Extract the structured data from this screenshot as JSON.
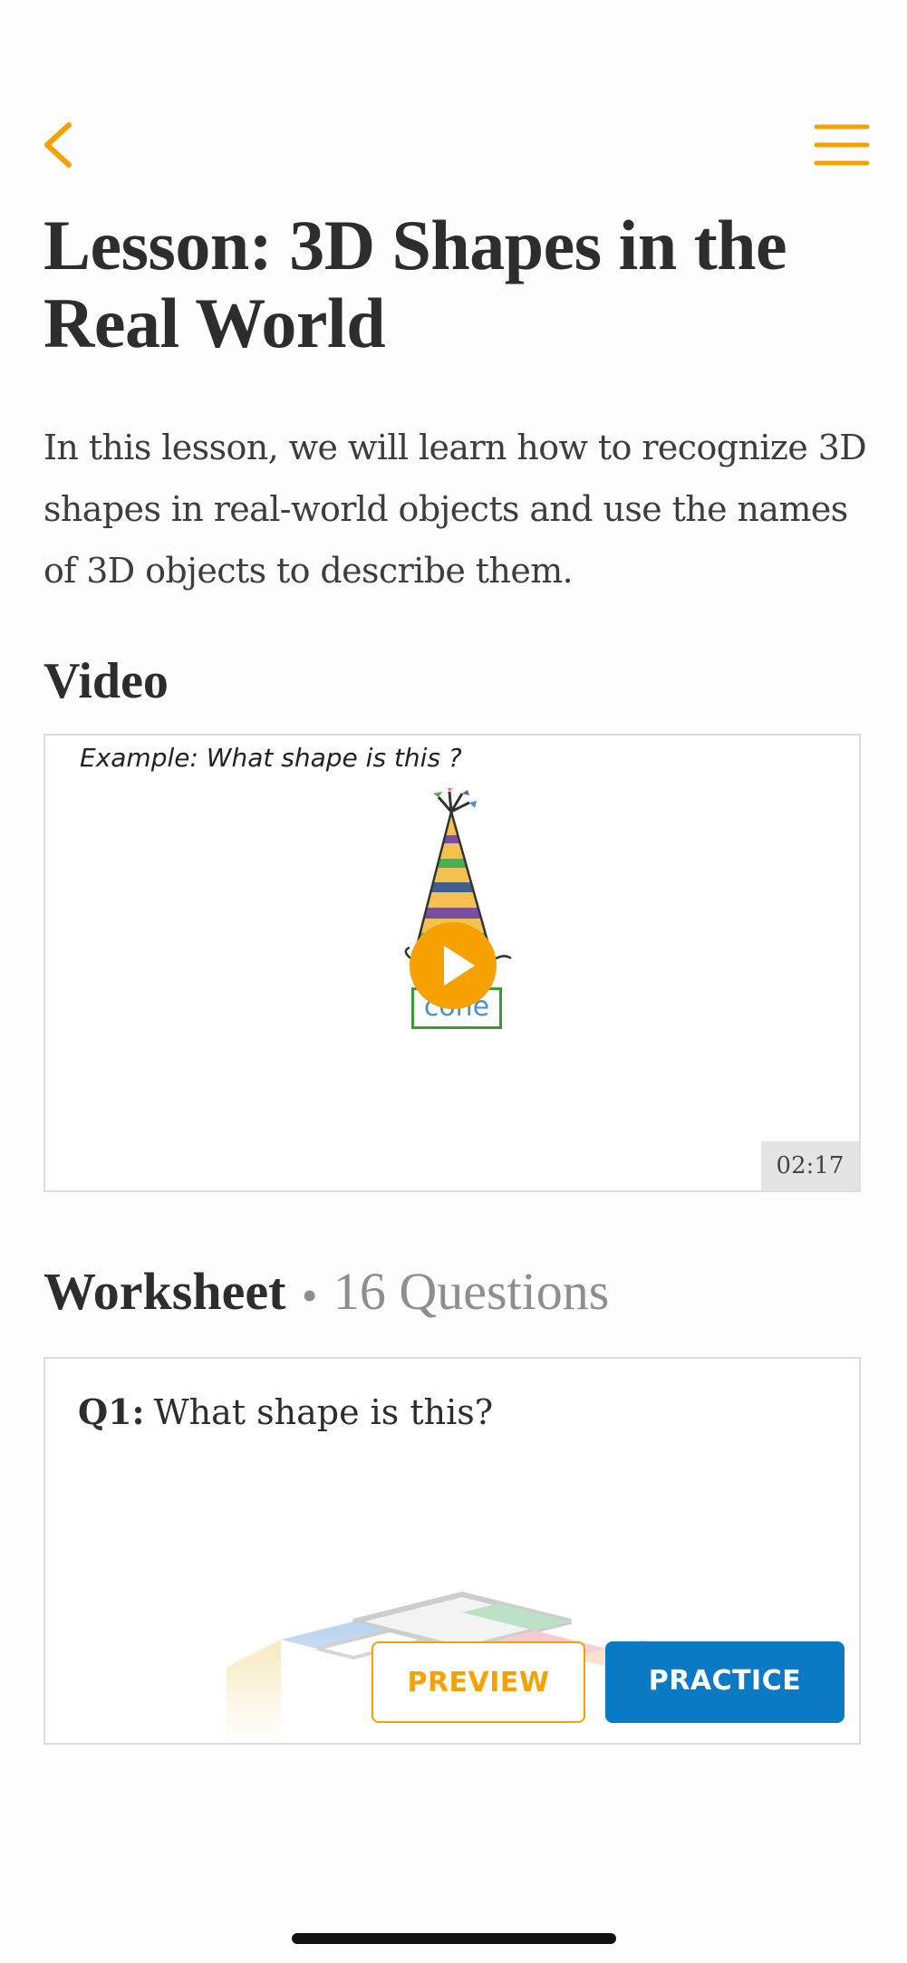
{
  "header": {
    "back_icon": "chevron-left-icon",
    "menu_icon": "hamburger-menu-icon",
    "accent_color": "#f5a100"
  },
  "lesson": {
    "title": "Lesson: 3D Shapes in the Real World",
    "description": "In this lesson, we will learn how to recognize 3D shapes in real-world objects and use the names of 3D objects to describe them."
  },
  "video": {
    "heading": "Video",
    "caption": "Example: What shape is this ?",
    "shape_label": "cone",
    "duration": "02:17",
    "play_icon": "play-icon"
  },
  "worksheet": {
    "heading": "Worksheet",
    "separator": "•",
    "question_count": "16 Questions",
    "question_number": "Q1:",
    "question_text": "What shape is this?",
    "preview_label": "PREVIEW",
    "practice_label": "PRACTICE",
    "practice_color": "#0a7ac4"
  }
}
